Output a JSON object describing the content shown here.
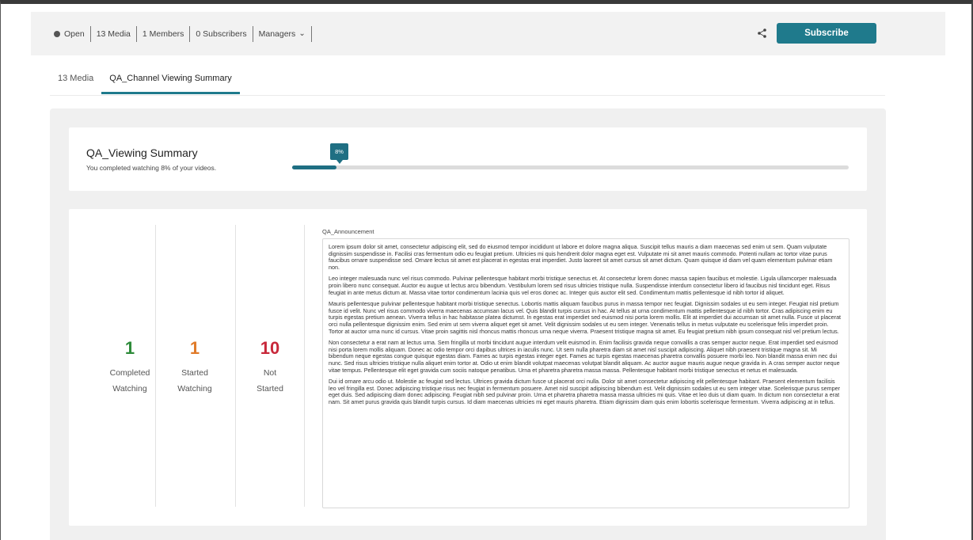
{
  "header": {
    "visibility": "Open",
    "media_count": "13 Media",
    "members": "1 Members",
    "subscribers": "0 Subscribers",
    "managers": "Managers",
    "subscribe_label": "Subscribe"
  },
  "tabs": [
    {
      "label": "13 Media",
      "active": false
    },
    {
      "label": "QA_Channel Viewing Summary",
      "active": true
    }
  ],
  "summary": {
    "title": "QA_Viewing Summary",
    "subtitle": "You completed watching 8% of your videos.",
    "progress_label": "8%",
    "progress_percent": 8
  },
  "stats": [
    {
      "value": "1",
      "label_line1": "Completed",
      "label_line2": "Watching",
      "color": "#2e8b3a"
    },
    {
      "value": "1",
      "label_line1": "Started",
      "label_line2": "Watching",
      "color": "#e07b2a"
    },
    {
      "value": "10",
      "label_line1": "Not",
      "label_line2": "Started",
      "color": "#c8283a"
    }
  ],
  "announcement": {
    "label": "QA_Announcement",
    "paragraphs": [
      "Lorem ipsum dolor sit amet, consectetur adipiscing elit, sed do eiusmod tempor incididunt ut labore et dolore magna aliqua. Suscipit tellus mauris a diam maecenas sed enim ut sem. Quam vulputate dignissim suspendisse in. Facilisi cras fermentum odio eu feugiat pretium. Ultricies mi quis hendrerit dolor magna eget est. Vulputate mi sit amet mauris commodo. Potenti nullam ac tortor vitae purus faucibus ornare suspendisse sed. Ornare lectus sit amet est placerat in egestas erat imperdiet. Justo laoreet sit amet cursus sit amet dictum. Quam quisque id diam vel quam elementum pulvinar etiam non.",
      "Leo integer malesuada nunc vel risus commodo. Pulvinar pellentesque habitant morbi tristique senectus et. At consectetur lorem donec massa sapien faucibus et molestie. Ligula ullamcorper malesuada proin libero nunc consequat. Auctor eu augue ut lectus arcu bibendum. Vestibulum lorem sed risus ultricies tristique nulla. Suspendisse interdum consectetur libero id faucibus nisl tincidunt eget. Risus feugiat in ante metus dictum at. Massa vitae tortor condimentum lacinia quis vel eros donec ac. Integer quis auctor elit sed. Condimentum mattis pellentesque id nibh tortor id aliquet.",
      "Mauris pellentesque pulvinar pellentesque habitant morbi tristique senectus. Lobortis mattis aliquam faucibus purus in massa tempor nec feugiat. Dignissim sodales ut eu sem integer. Feugiat nisl pretium fusce id velit. Nunc vel risus commodo viverra maecenas accumsan lacus vel. Quis blandit turpis cursus in hac. At tellus at urna condimentum mattis pellentesque id nibh tortor. Cras adipiscing enim eu turpis egestas pretium aenean. Viverra tellus in hac habitasse platea dictumst. In egestas erat imperdiet sed euismod nisi porta lorem mollis. Elit at imperdiet dui accumsan sit amet nulla. Fusce ut placerat orci nulla pellentesque dignissim enim. Sed enim ut sem viverra aliquet eget sit amet. Velit dignissim sodales ut eu sem integer. Venenatis tellus in metus vulputate eu scelerisque felis imperdiet proin. Tortor at auctor urna nunc id cursus. Vitae proin sagittis nisl rhoncus mattis rhoncus urna neque viverra. Praesent tristique magna sit amet. Eu feugiat pretium nibh ipsum consequat nisl vel pretium lectus.",
      "Non consectetur a erat nam at lectus urna. Sem fringilla ut morbi tincidunt augue interdum velit euismod in. Enim facilisis gravida neque convallis a cras semper auctor neque. Erat imperdiet sed euismod nisi porta lorem mollis aliquam. Donec ac odio tempor orci dapibus ultrices in iaculis nunc. Ut sem nulla pharetra diam sit amet nisl suscipit adipiscing. Aliquet nibh praesent tristique magna sit. Mi bibendum neque egestas congue quisque egestas diam. Fames ac turpis egestas integer eget. Fames ac turpis egestas maecenas pharetra convallis posuere morbi leo. Non blandit massa enim nec dui nunc. Sed risus ultricies tristique nulla aliquet enim tortor at. Odio ut enim blandit volutpat maecenas volutpat blandit aliquam. Ac auctor augue mauris augue neque gravida in. A cras semper auctor neque vitae tempus. Pellentesque elit eget gravida cum sociis natoque penatibus. Urna et pharetra pharetra massa massa. Pellentesque habitant morbi tristique senectus et netus et malesuada.",
      "Dui id ornare arcu odio ut. Molestie ac feugiat sed lectus. Ultrices gravida dictum fusce ut placerat orci nulla. Dolor sit amet consectetur adipiscing elit pellentesque habitant. Praesent elementum facilisis leo vel fringilla est. Donec adipiscing tristique risus nec feugiat in fermentum posuere. Amet nisl suscipit adipiscing bibendum est. Velit dignissim sodales ut eu sem integer vitae. Scelerisque purus semper eget duis. Sed adipiscing diam donec adipiscing. Feugiat nibh sed pulvinar proin. Urna et pharetra pharetra massa massa ultricies mi quis. Vitae et leo duis ut diam quam. In dictum non consectetur a erat nam. Sit amet purus gravida quis blandit turpis cursus. Id diam maecenas ultricies mi eget mauris pharetra. Etiam dignissim diam quis enim lobortis scelerisque fermentum. Viverra adipiscing at in tellus."
    ]
  },
  "colors": {
    "accent": "#1f7a8c"
  }
}
